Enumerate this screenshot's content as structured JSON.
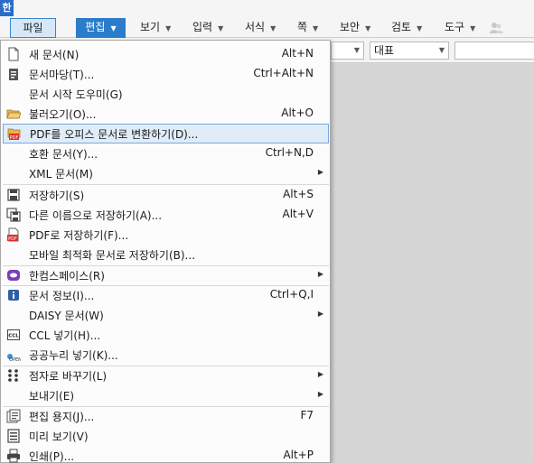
{
  "app": {
    "logo": "한"
  },
  "menubar": {
    "tabs": [
      {
        "label": "파일"
      },
      {
        "label": "편집"
      },
      {
        "label": "보기"
      },
      {
        "label": "입력"
      },
      {
        "label": "서식"
      },
      {
        "label": "쪽"
      },
      {
        "label": "보안"
      },
      {
        "label": "검토"
      },
      {
        "label": "도구"
      }
    ]
  },
  "toolbar": {
    "style_combo_value": "대표"
  },
  "file_menu": {
    "items": [
      {
        "label": "새 문서(N)",
        "shortcut": "Alt+N",
        "icon": "new-document-icon"
      },
      {
        "label": "문서마당(T)...",
        "shortcut": "Ctrl+Alt+N",
        "icon": "document-template-icon"
      },
      {
        "label": "문서 시작 도우미(G)",
        "shortcut": "",
        "icon": ""
      },
      {
        "label": "불러오기(O)...",
        "shortcut": "Alt+O",
        "icon": "open-folder-icon"
      },
      {
        "label": "PDF를 오피스 문서로 변환하기(D)...",
        "shortcut": "",
        "icon": "pdf-convert-icon"
      },
      {
        "label": "호환 문서(Y)...",
        "shortcut": "Ctrl+N,D",
        "icon": ""
      },
      {
        "label": "XML 문서(M)",
        "shortcut": "",
        "icon": ""
      },
      {
        "label": "저장하기(S)",
        "shortcut": "Alt+S",
        "icon": "save-icon"
      },
      {
        "label": "다른 이름으로 저장하기(A)...",
        "shortcut": "Alt+V",
        "icon": "save-as-icon"
      },
      {
        "label": "PDF로 저장하기(F)...",
        "shortcut": "",
        "icon": "save-pdf-icon"
      },
      {
        "label": "모바일 최적화 문서로 저장하기(B)...",
        "shortcut": "",
        "icon": ""
      },
      {
        "label": "한컴스페이스(R)",
        "shortcut": "",
        "icon": "hancom-space-icon"
      },
      {
        "label": "문서 정보(I)...",
        "shortcut": "Ctrl+Q,I",
        "icon": "info-icon"
      },
      {
        "label": "DAISY 문서(W)",
        "shortcut": "",
        "icon": ""
      },
      {
        "label": "CCL 넣기(H)...",
        "shortcut": "",
        "icon": "ccl-icon"
      },
      {
        "label": "공공누리 넣기(K)...",
        "shortcut": "",
        "icon": "kogl-icon"
      },
      {
        "label": "점자로 바꾸기(L)",
        "shortcut": "",
        "icon": "braille-icon"
      },
      {
        "label": "보내기(E)",
        "shortcut": "",
        "icon": ""
      },
      {
        "label": "편집 용지(J)...",
        "shortcut": "F7",
        "icon": "page-setup-icon"
      },
      {
        "label": "미리 보기(V)",
        "shortcut": "",
        "icon": "print-preview-icon"
      },
      {
        "label": "인쇄(P)...",
        "shortcut": "Alt+P",
        "icon": "print-icon"
      }
    ]
  },
  "colors": {
    "accent": "#2b7ccb",
    "highlight_bg": "#e1ecf9",
    "highlight_border": "#7aa7dd"
  }
}
